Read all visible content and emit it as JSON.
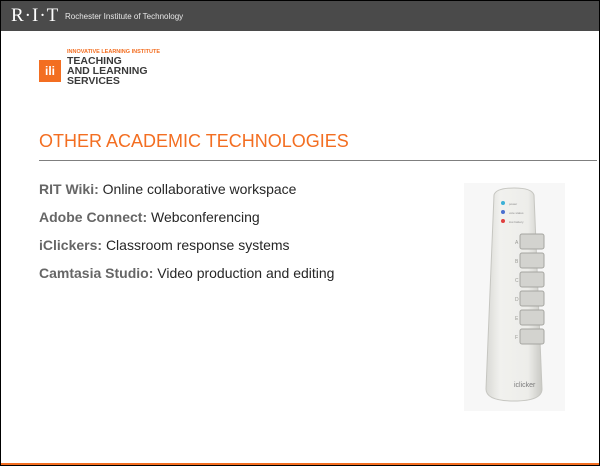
{
  "header": {
    "logo_text": "R·I·T",
    "institution": "Rochester Institute of Technology"
  },
  "unit": {
    "institute": "INNOVATIVE LEARNING INSTITUTE",
    "name_line1": "TEACHING",
    "name_line2": "AND LEARNING",
    "name_line3": "SERVICES"
  },
  "slide": {
    "title": "OTHER ACADEMIC TECHNOLOGIES",
    "items": [
      {
        "term": "RIT Wiki:",
        "description": "Online collaborative workspace"
      },
      {
        "term": "Adobe Connect:",
        "description": "Webconferencing"
      },
      {
        "term": "iClickers:",
        "description": "Classroom response systems"
      },
      {
        "term": "Camtasia Studio:",
        "description": "Video production and editing"
      }
    ]
  },
  "image": {
    "brand_text": "iclicker",
    "led_labels": [
      "power",
      "vote status",
      "low battery"
    ],
    "button_labels": [
      "A",
      "B",
      "C",
      "D",
      "E",
      "F"
    ]
  },
  "colors": {
    "accent": "#f36e21",
    "topbar": "#4a4a4a",
    "term_text": "#666666"
  }
}
